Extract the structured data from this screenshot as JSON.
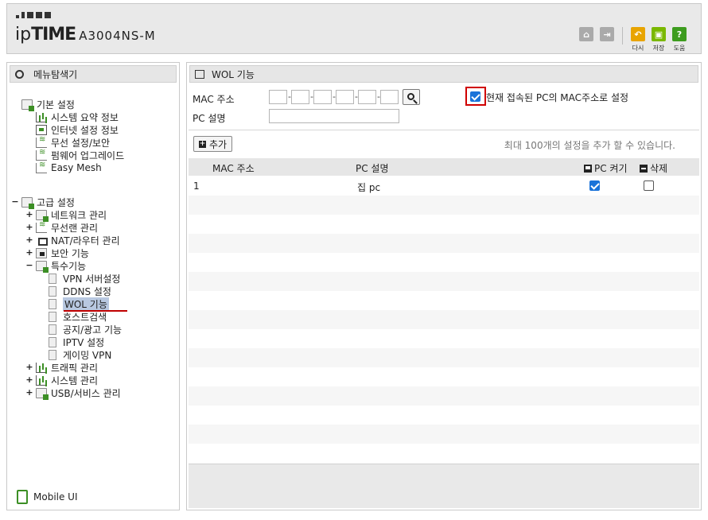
{
  "header": {
    "brand_ip": "ip",
    "brand_time": "TIME",
    "model": "A3004NS-M",
    "home_icon": "home-icon",
    "logout_icon": "logout-icon",
    "reload_label": "다시",
    "save_label": "저장",
    "help_label": "도움"
  },
  "sidebar": {
    "title": "메뉴탐색기",
    "basic": {
      "label": "기본 설정",
      "items": [
        "시스템 요약 정보",
        "인터넷 설정 정보",
        "무선 설정/보안",
        "펌웨어 업그레이드",
        "Easy Mesh"
      ]
    },
    "advanced": {
      "label": "고급 설정",
      "items": [
        "네트워크 관리",
        "무선랜 관리",
        "NAT/라우터 관리",
        "보안 기능",
        "특수기능"
      ],
      "special": [
        "VPN 서버설정",
        "DDNS 설정",
        "WOL 기능",
        "호스트검색",
        "공지/광고 기능",
        "IPTV 설정",
        "게이밍 VPN"
      ],
      "after": [
        "트래픽 관리",
        "시스템 관리",
        "USB/서비스 관리"
      ]
    },
    "mobile_ui": "Mobile UI"
  },
  "main": {
    "title": "WOL 기능",
    "mac_label": "MAC 주소",
    "mac_fields": [
      "",
      "",
      "",
      "",
      "",
      ""
    ],
    "pc_desc_label": "PC 설명",
    "pc_desc_value": "",
    "use_current_mac_label": "현재 접속된 PC의 MAC주소로 설정",
    "use_current_mac_checked": true,
    "add_button": "추가",
    "max_note": "최대 100개의 설정을 추가 할 수 있습니다.",
    "table": {
      "columns": [
        "MAC 주소",
        "PC 설명",
        "PC 켜기",
        "삭제"
      ],
      "rows": [
        {
          "mac": "1",
          "desc": "집 pc",
          "power_on": true,
          "delete": false
        }
      ]
    }
  },
  "colors": {
    "accent_red": "#d00000",
    "checkbox_blue": "#1a73d9",
    "icon_green": "#3c8f25"
  }
}
